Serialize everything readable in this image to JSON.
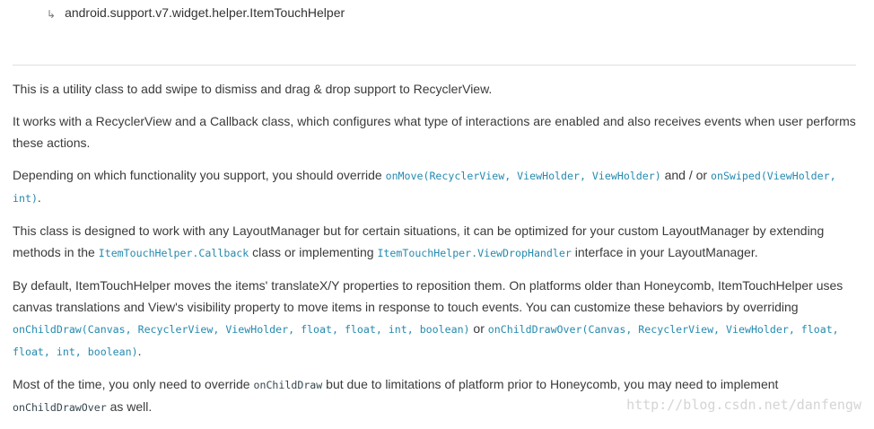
{
  "header": {
    "inherit_arrow": "↳",
    "class_path": "android.support.v7.widget.helper.ItemTouchHelper"
  },
  "paragraphs": {
    "p1": {
      "text": "This is a utility class to add swipe to dismiss and drag & drop support to RecyclerView."
    },
    "p2": {
      "text": "It works with a RecyclerView and a Callback class, which configures what type of interactions are enabled and also receives events when user performs these actions."
    },
    "p3": {
      "t1": "Depending on which functionality you support, you should override ",
      "link1": "onMove(RecyclerView, ViewHolder, ViewHolder)",
      "t2": " and / or ",
      "link2": "onSwiped(ViewHolder, int)",
      "t3": "."
    },
    "p4": {
      "t1": "This class is designed to work with any LayoutManager but for certain situations, it can be optimized for your custom LayoutManager by extending methods in the ",
      "link1": "ItemTouchHelper.Callback",
      "t2": " class or implementing ",
      "link2": "ItemTouchHelper.ViewDropHandler",
      "t3": " interface in your LayoutManager."
    },
    "p5": {
      "t1": "By default, ItemTouchHelper moves the items' translateX/Y properties to reposition them. On platforms older than Honeycomb, ItemTouchHelper uses canvas translations and View's visibility property to move items in response to touch events. You can customize these behaviors by overriding ",
      "link1": "onChildDraw(Canvas, RecyclerView, ViewHolder, float, float, int, boolean)",
      "t2": " or ",
      "link2": "onChildDrawOver(Canvas, RecyclerView, ViewHolder, float, float, int, boolean)",
      "t3": "."
    },
    "p6": {
      "t1": "Most of the time, you only need to override ",
      "code1": "onChildDraw",
      "t2": " but due to limitations of platform prior to Honeycomb, you may need to implement ",
      "code2": "onChildDrawOver",
      "t3": " as well."
    }
  },
  "watermark": "http://blog.csdn.net/danfengw"
}
